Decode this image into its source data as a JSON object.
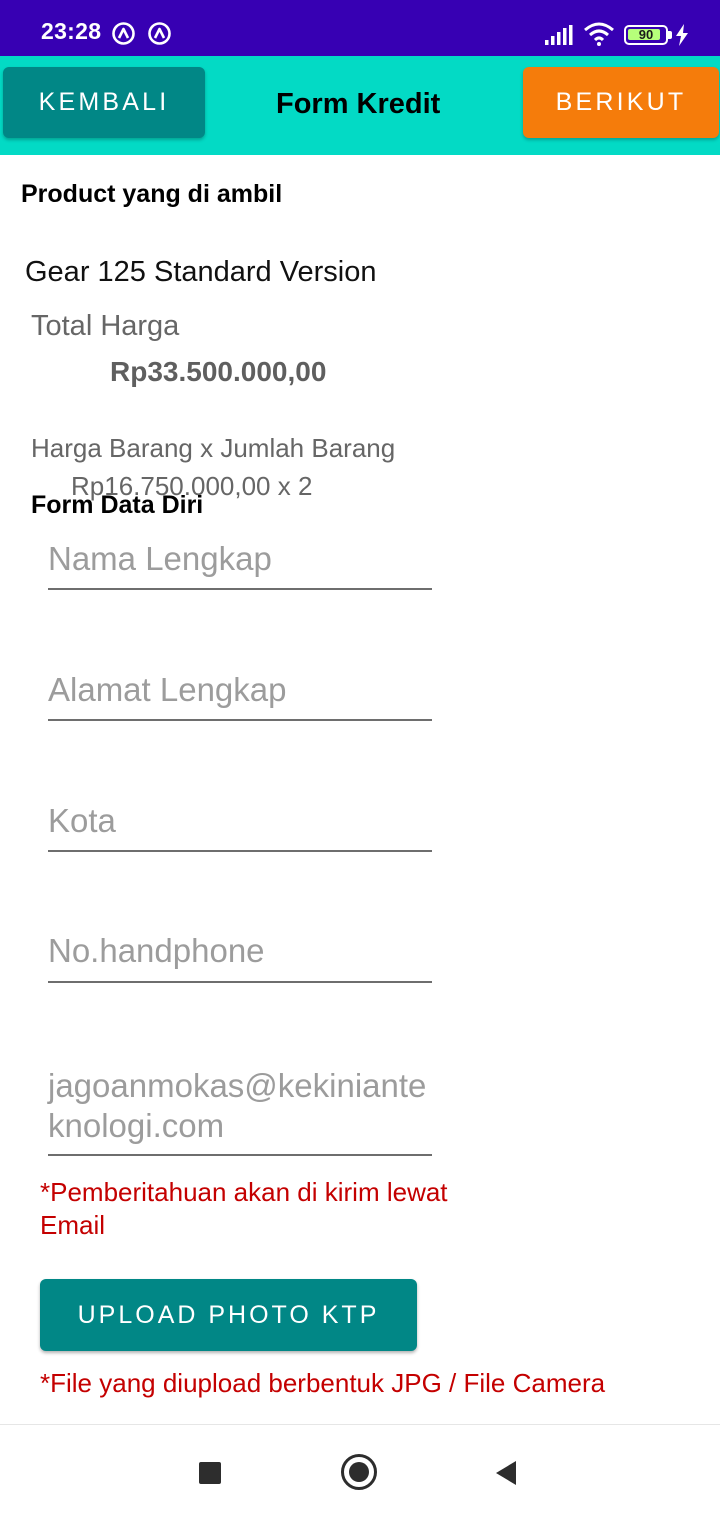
{
  "status_bar": {
    "time": "23:28",
    "battery_level": "90",
    "battery_fraction": 0.9,
    "icons": [
      "notification-icon",
      "notification-icon",
      "signal-icon",
      "wifi-icon",
      "battery-icon",
      "charging-icon"
    ]
  },
  "toolbar": {
    "back_label": "KEMBALI",
    "title": "Form Kredit",
    "next_label": "BERIKUT"
  },
  "product": {
    "header": "Product yang di ambil",
    "name": "Gear 125 Standard Version",
    "total_label": "Total Harga",
    "total_value": "Rp33.500.000,00",
    "formula_label": "Harga Barang x Jumlah Barang",
    "formula_value": "Rp16.750.000,00 x 2"
  },
  "form": {
    "header": "Form Data Diri",
    "full_name_placeholder": "Nama Lengkap",
    "address_placeholder": "Alamat Lengkap",
    "city_placeholder": "Kota",
    "phone_placeholder": "No.handphone",
    "email_placeholder": "jagoanmokas@kekinianteknologi.com",
    "email_note": "*Pemberitahuan akan di kirim lewat Email",
    "upload_label": "UPLOAD PHOTO KTP",
    "file_note": "*File yang diupload berbentuk JPG / File Camera"
  },
  "colors": {
    "status_bar": "#3700b3",
    "toolbar": "#03dac5",
    "primary_button": "#018786",
    "next_button": "#f57c0b",
    "warning_text": "#c40000"
  }
}
